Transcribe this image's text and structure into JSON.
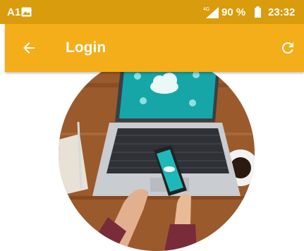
{
  "status_bar": {
    "carrier": "A1",
    "network": "4G",
    "battery": "90 %",
    "time": "23:32"
  },
  "app_bar": {
    "title": "Login",
    "back_icon": "arrow-back-icon",
    "refresh_icon": "refresh-icon"
  },
  "hero_image": {
    "subject": "laptop and smartphone with cloud computing icons on a wooden desk"
  },
  "colors": {
    "status_bar": "#d99c0d",
    "app_bar": "#f4ae19",
    "background": "#ffffff"
  }
}
